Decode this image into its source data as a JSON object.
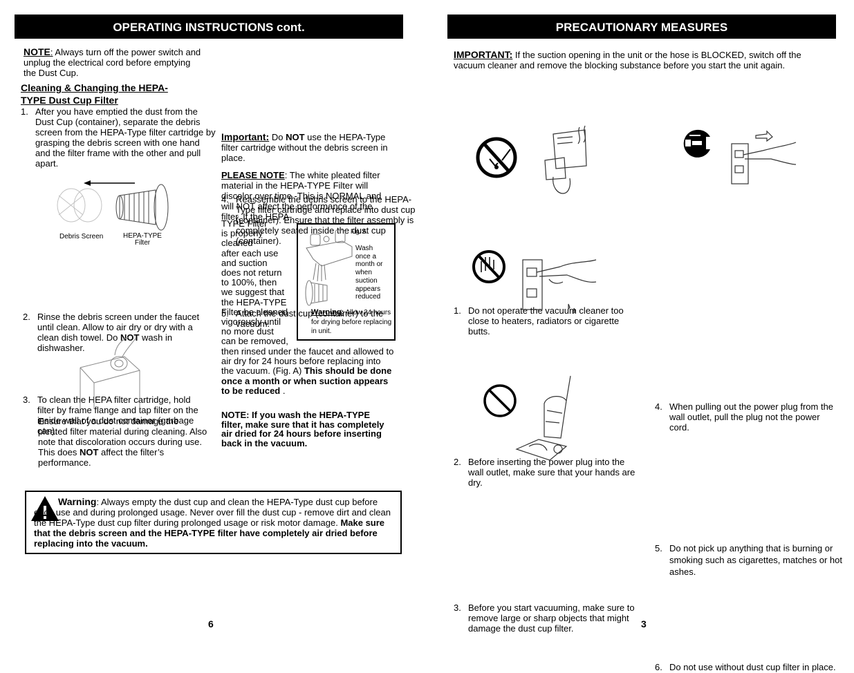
{
  "left_page": {
    "banner_title": "OPERATING INSTRUCTIONS cont.",
    "note": {
      "label": "NOTE",
      "colon": ":",
      "text": "  Always turn off the power switch and unplug the electrical cord before emptying the Dust Cup."
    },
    "section_heading_line1": "Cleaning & Changing the HEPA-",
    "section_heading_line2": "TYPE Dust Cup Filter",
    "steps": [
      {
        "num": "1.",
        "text": "After you have emptied the dust from the Dust Cup (container), separate the debris screen from the HEPA-Type filter cartridge by grasping the debris screen with one hand and the filter frame with the other and pull apart."
      },
      {
        "num": "2.",
        "text_a": "Rinse the debris screen under the faucet until clean. Allow to air dry or dry with a clean dish towel. Do ",
        "bold": "NOT",
        "text_b": " wash in dishwasher."
      },
      {
        "num": "3.",
        "text": "To clean the HEPA filter cartridge, hold filter by frame flange and tap filter on the inside wall of a dust container (garbage can)."
      },
      {
        "num": "4.",
        "text": "Reassemble the debris screen to the HEPA-Type filter cartridge and replace into dust cup (container). Ensure that the filter assembly is completely seated inside the dust cup (container)."
      },
      {
        "num": "5.",
        "text": "Attach the dust cup (container) to the vacuum."
      }
    ],
    "figure_labels": {
      "debris_screen": "Debris Screen",
      "hepa_filter_line1": "HEPA-TYPE",
      "hepa_filter_line2": "Filter"
    },
    "ensure_text_a": "Ensure that you do not damage the pleated filter material during cleaning. Also note that discoloration occurs during use.  This does ",
    "ensure_bold": "NOT",
    "ensure_text_b": " affect the filter’s performance.",
    "important": {
      "label": "Important:",
      "text_a": " Do ",
      "bold": "NOT",
      "text_b": " use the HEPA-Type filter cartridge without the debris screen in place."
    },
    "please_note": {
      "label": "PLEASE NOTE",
      "text": ": The white pleated filter material in the HEPA-TYPE Filter will discolor over time -This is NORMAL and will NOT affect the performance of the filter. If the HEPA-",
      "wrapped_lines": [
        "TYPE Filter",
        "is properly",
        "cleaned",
        "after each use",
        "and suction",
        "does not return",
        "to 100%, then",
        "we suggest that",
        "the HEPA-TYPE",
        "Filter be cleaned",
        "vigorously until",
        "no more dust",
        "can be removed,"
      ],
      "continuation": "then rinsed under the faucet and allowed to air dry for 24 hours before replacing into the vacuum. (Fig. A) ",
      "bold_tail": "This should be done once a month or when suction appears to be reduced",
      "end": " ."
    },
    "fig_a": {
      "label": "Fig. A",
      "wash_lines": [
        "Wash",
        "once a",
        "month or",
        "when",
        "suction",
        "appears",
        "reduced"
      ],
      "warning_label": "Warning:",
      "warning_text": " Allow 24 hours for drying before replacing in unit."
    },
    "wash_note": "NOTE: If you wash the HEPA-TYPE filter, make sure that it has completely air dried for 24 hours before inserting back in the vacuum.",
    "warning_box": {
      "label": "Warning",
      "text": ": Always empty the dust cup and clean the HEPA-Type dust cup before each use and during prolonged usage. Never over fill the dust cup - remove dirt and clean the HEPA-Type dust cup filter during prolonged usage or risk motor damage. ",
      "bold": "Make sure that the debris screen and the HEPA-TYPE filter have completely air dried before replacing into the vacuum."
    },
    "page_number": "6"
  },
  "right_page": {
    "banner_title": "PRECAUTIONARY MEASURES",
    "important": {
      "label": "IMPORTANT:",
      "text": "   If the suction opening in the unit or the hose is BLOCKED, switch off the vacuum cleaner and remove the blocking substance before you start the unit again."
    },
    "items": [
      {
        "num": "1.",
        "text": "Do not operate the vacuum cleaner too close to heaters, radiators or cigarette butts."
      },
      {
        "num": "2.",
        "text": "Before inserting the power plug into the wall outlet, make sure that your hands are dry."
      },
      {
        "num": "3.",
        "text": "Before you start vacuuming, make sure to remove large or sharp objects that might damage the dust cup filter."
      },
      {
        "num": "4.",
        "text": "When pulling out the power plug from the wall outlet, pull the plug not the power cord."
      },
      {
        "num": "5.",
        "text": "Do not pick up anything that is burning or smoking such as cigarettes, matches or hot ashes."
      },
      {
        "num": "6.",
        "text": "Do not use without dust cup filter in place."
      }
    ],
    "page_number": "3"
  }
}
